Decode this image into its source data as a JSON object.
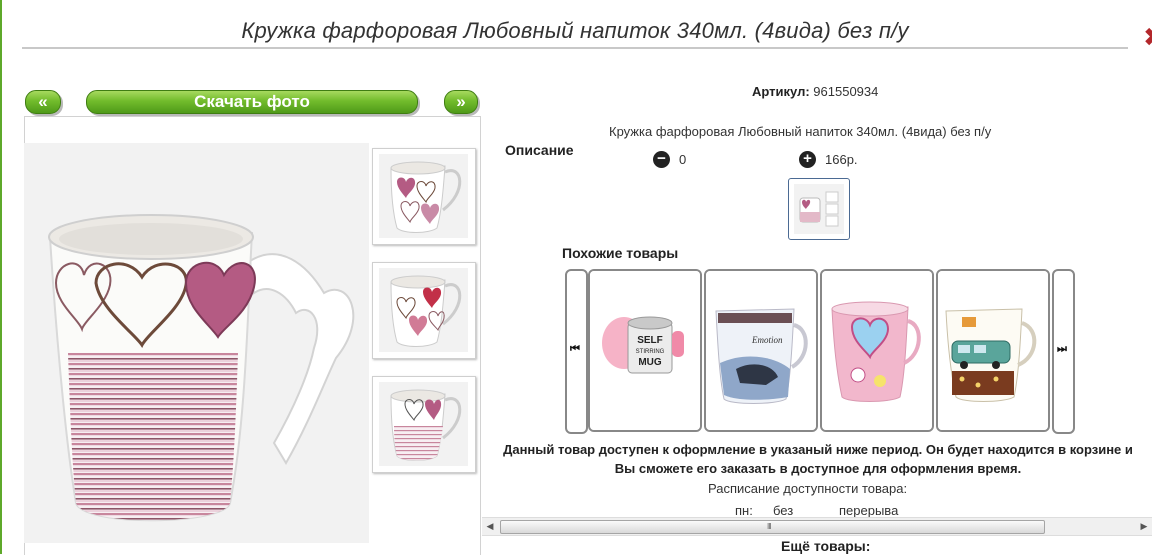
{
  "page": {
    "title": "Кружка фарфоровая Любовный напиток 340мл. (4вида) без п/у",
    "close_glyph": "✖",
    "accent_color": "#5ea92a",
    "close_color": "#b3272b"
  },
  "gallery": {
    "prev_label": "«",
    "next_label": "»",
    "download_label": "Скачать фото"
  },
  "product": {
    "article_label": "Артикул:",
    "article_value": "961550934",
    "description_label": "Описание",
    "description_text": "Кружка фарфоровая Любовный напиток 340мл. (4вида) без п/у",
    "minus_glyph": "−",
    "plus_glyph": "+",
    "minus_value": "0",
    "plus_value": "166р."
  },
  "similar": {
    "title": "Похожие товары",
    "prev_glyph": "⏮",
    "next_glyph": "⏭",
    "items": [
      {
        "name": "self-stirring-mug",
        "printed_text": "SELF STIRRING MUG"
      },
      {
        "name": "car-photo-mug",
        "printed_text": "Emotion"
      },
      {
        "name": "pink-heart-mug",
        "printed_text": ""
      },
      {
        "name": "retro-van-mug",
        "printed_text": ""
      }
    ]
  },
  "availability": {
    "notice": "Данный товар доступен к оформление в указаный ниже период. Он будет находится в корзине и Вы сможете его заказать в доступное для оформления время.",
    "schedule_title": "Расписание доступности товара:",
    "day": "пн:",
    "value1": "без",
    "value2": "перерыва"
  },
  "scrollbar": {
    "left_glyph": "◀",
    "right_glyph": "▶",
    "grip_glyph": "III"
  },
  "more": {
    "title": "Ещё товары:"
  }
}
